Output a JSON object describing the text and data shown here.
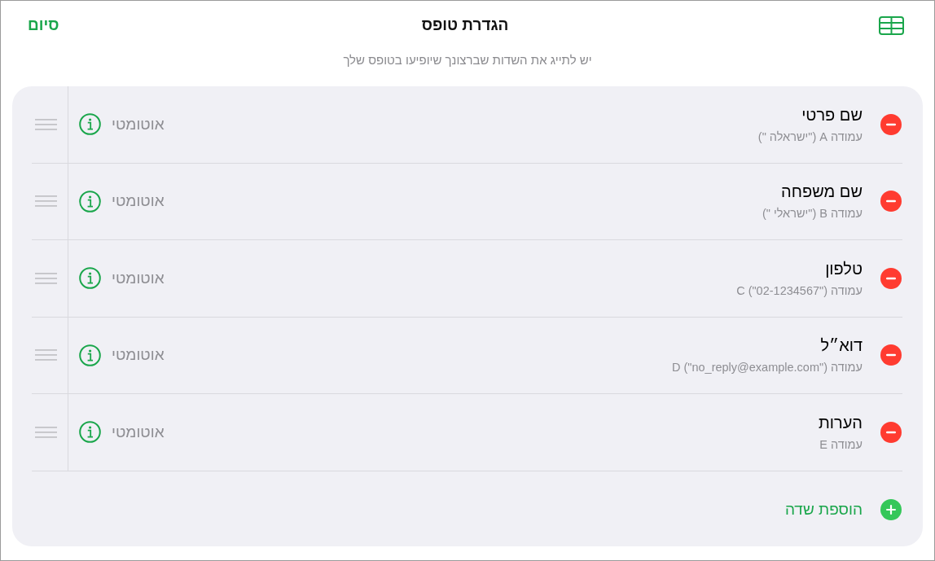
{
  "header": {
    "done": "סיום",
    "title": "הגדרת טופס",
    "subtitle": "יש לתייג את השדות שברצונך שיופיעו בטופס שלך"
  },
  "fields": [
    {
      "name": "שם פרטי",
      "column": "עמודה A (\"ישראלה \")",
      "format": "אוטומטי"
    },
    {
      "name": "שם משפחה",
      "column": "עמודה B (\"ישראלי \")",
      "format": "אוטומטי"
    },
    {
      "name": "טלפון",
      "column": "עמודה C (\"02-1234567\")",
      "format": "אוטומטי"
    },
    {
      "name": "דוא״ל",
      "column": "עמודה D (\"no_reply@example.com\")",
      "format": "אוטומטי"
    },
    {
      "name": "הערות",
      "column": "עמודה E",
      "format": "אוטומטי"
    }
  ],
  "add_field": "הוספת שדה"
}
